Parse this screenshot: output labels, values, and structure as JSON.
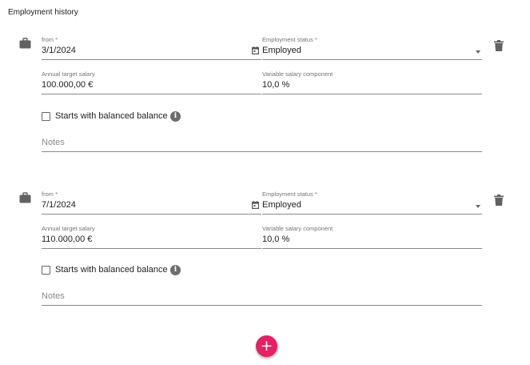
{
  "section_title": "Employment history",
  "entries": [
    {
      "from_label": "from *",
      "from_value": "3/1/2024",
      "status_label": "Employment status *",
      "status_value": "Employed",
      "salary_label": "Annual target salary",
      "salary_value": "100.000,00 €",
      "variable_label": "Variable salary component",
      "variable_value": "10,0 %",
      "checkbox_label": "Starts with balanced balance",
      "checkbox_checked": false,
      "notes_placeholder": "Notes"
    },
    {
      "from_label": "from *",
      "from_value": "7/1/2024",
      "status_label": "Employment status *",
      "status_value": "Employed",
      "salary_label": "Annual target salary",
      "salary_value": "110.000,00 €",
      "variable_label": "Variable salary component",
      "variable_value": "10,0 %",
      "checkbox_label": "Starts with balanced balance",
      "checkbox_checked": false,
      "notes_placeholder": "Notes"
    }
  ],
  "icons": {
    "entry": "briefcase-icon",
    "delete": "trash-icon",
    "date": "calendar-icon",
    "dropdown": "arrow-drop-down-icon",
    "info": "info-icon",
    "add": "plus-icon"
  },
  "colors": {
    "accent": "#e91e63",
    "icon": "#616161",
    "underline": "#8a8a8a"
  },
  "add_button_symbol": "+"
}
